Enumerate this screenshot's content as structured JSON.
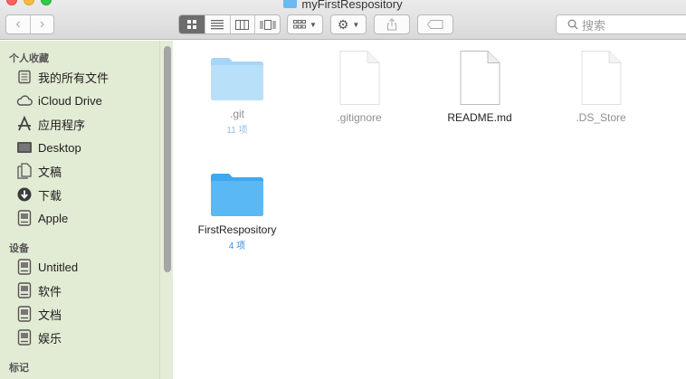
{
  "window": {
    "title": "myFirstRespository"
  },
  "toolbar": {
    "search_placeholder": "搜索",
    "view_modes": [
      "icon-view",
      "list-view",
      "column-view",
      "coverflow-view"
    ],
    "active_view": "icon-view"
  },
  "sidebar": {
    "sections": [
      {
        "header": "个人收藏",
        "items": [
          {
            "label": "我的所有文件",
            "icon": "all-files-icon"
          },
          {
            "label": "iCloud Drive",
            "icon": "cloud-icon"
          },
          {
            "label": "应用程序",
            "icon": "applications-icon"
          },
          {
            "label": "Desktop",
            "icon": "desktop-icon"
          },
          {
            "label": "文稿",
            "icon": "documents-icon"
          },
          {
            "label": "下载",
            "icon": "download-icon"
          },
          {
            "label": "Apple",
            "icon": "home-drive-icon"
          }
        ]
      },
      {
        "header": "设备",
        "items": [
          {
            "label": "Untitled",
            "icon": "disk-icon"
          },
          {
            "label": "软件",
            "icon": "disk-icon"
          },
          {
            "label": "文档",
            "icon": "disk-icon"
          },
          {
            "label": "娱乐",
            "icon": "disk-icon"
          }
        ]
      },
      {
        "header": "标记",
        "items": []
      }
    ]
  },
  "files": [
    {
      "name": ".git",
      "kind": "folder",
      "hidden": true,
      "count": "11 项"
    },
    {
      "name": ".gitignore",
      "kind": "document",
      "hidden": true,
      "count": ""
    },
    {
      "name": "README.md",
      "kind": "document",
      "hidden": false,
      "count": ""
    },
    {
      "name": ".DS_Store",
      "kind": "document",
      "hidden": true,
      "count": ""
    },
    {
      "name": "FirstRespository",
      "kind": "folder",
      "hidden": false,
      "count": "4 项"
    }
  ],
  "colors": {
    "folder": "#5ab8f5",
    "folder_dim": "#b3dcf7",
    "sidebar_bg": "#e2ebd4",
    "accent_count": "#3d8fe0"
  }
}
